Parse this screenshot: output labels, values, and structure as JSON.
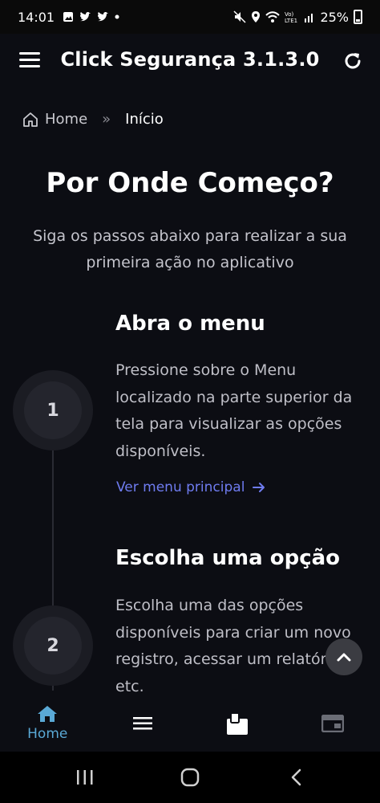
{
  "status_bar": {
    "time": "14:01",
    "battery": "25%"
  },
  "app": {
    "title": "Click Segurança 3.1.3.0"
  },
  "breadcrumb": {
    "home": "Home",
    "separator": "»",
    "current": "Início"
  },
  "hero": {
    "title": "Por Onde Começo?",
    "subtitle": "Siga os passos abaixo para realizar a sua primeira ação no aplicativo"
  },
  "steps": [
    {
      "number": "1",
      "title": "Abra o menu",
      "description": "Pressione sobre o Menu localizado na parte superior da tela para visualizar as opções disponíveis.",
      "link": "Ver menu principal"
    },
    {
      "number": "2",
      "title": "Escolha uma opção",
      "description": "Escolha uma das opções disponíveis para criar um novo registro, acessar um relatório, etc."
    }
  ],
  "bottom_nav": {
    "items": [
      {
        "label": "Home",
        "icon": "home-icon",
        "active": true
      },
      {
        "label": "",
        "icon": "menu-icon",
        "active": false
      },
      {
        "label": "",
        "icon": "clipboard-icon",
        "active": false
      },
      {
        "label": "",
        "icon": "browser-window-icon",
        "active": false
      }
    ]
  },
  "colors": {
    "background": "#0c0d13",
    "accent_link": "#6f7cf0",
    "active_nav": "#5aa9d6"
  }
}
